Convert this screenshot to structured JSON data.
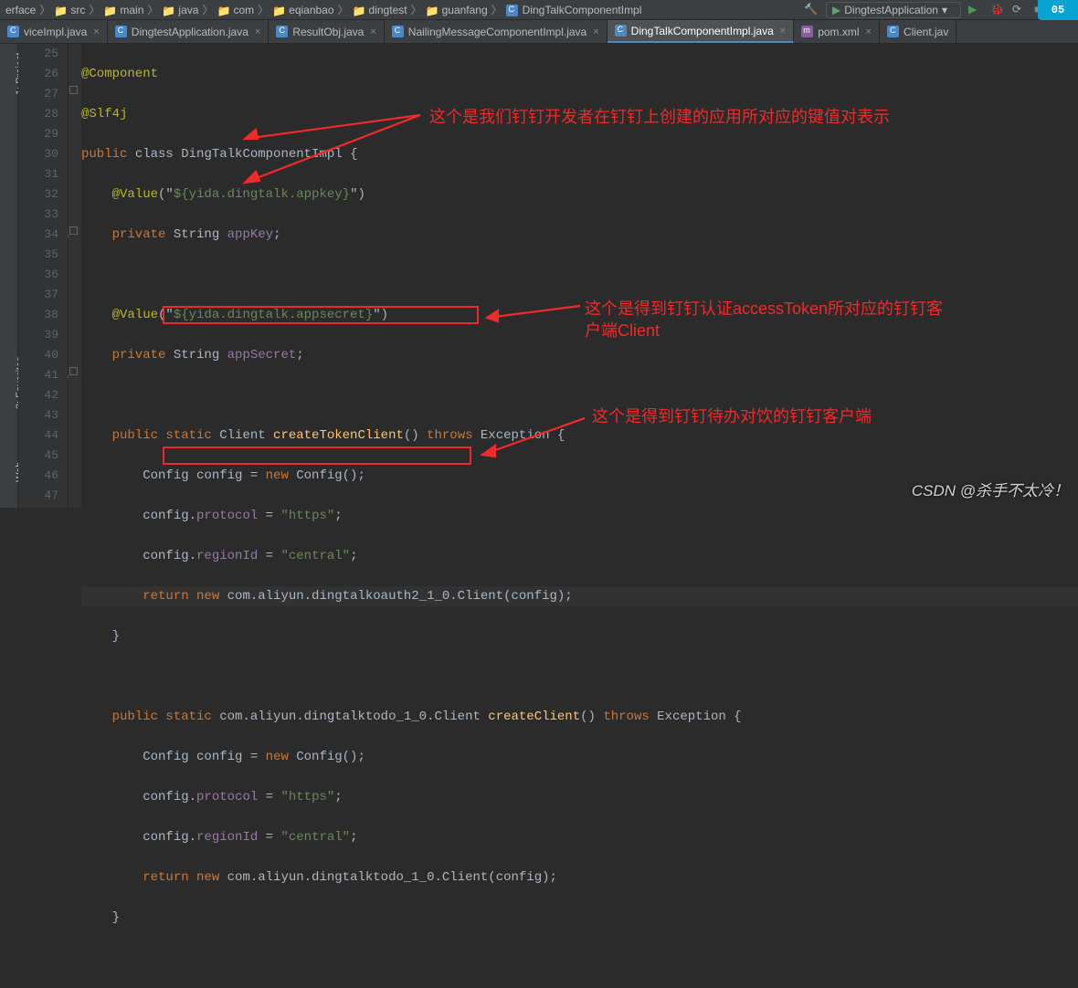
{
  "breadcrumb": {
    "parts": [
      "erface",
      "src",
      "main",
      "java",
      "com",
      "eqianbao",
      "dingtest",
      "guanfang",
      "DingTalkComponentImpl"
    ],
    "run_config": "DingtestApplication"
  },
  "tabs": [
    {
      "label": "viceImpl.java",
      "icon": "class-icon"
    },
    {
      "label": "DingtestApplication.java",
      "icon": "class-icon"
    },
    {
      "label": "ResultObj.java",
      "icon": "class-icon"
    },
    {
      "label": "NailingMessageComponentImpl.java",
      "icon": "class-icon"
    },
    {
      "label": "DingTalkComponentImpl.java",
      "icon": "class-icon",
      "active": true
    },
    {
      "label": "pom.xml",
      "icon": "maven-icon"
    },
    {
      "label": "Client.jav",
      "icon": "class-icon"
    }
  ],
  "gutter": {
    "start": 25,
    "end": 47
  },
  "code": {
    "l25": "@Component",
    "l26": "@Slf4j",
    "l27_a": "public",
    "l27_b": " class ",
    "l27_c": "DingTalkComponentImpl {",
    "l28_a": "    @Value",
    "l28_b": "(\"",
    "l28_c": "${yida.dingtalk.appkey}",
    "l28_d": "\")",
    "l29_a": "    private ",
    "l29_b": "String ",
    "l29_c": "appKey",
    "l29_d": ";",
    "l30": "",
    "l31_a": "    @Value",
    "l31_b": "(\"",
    "l31_c": "${yida.dingtalk.appsecret}",
    "l31_d": "\")",
    "l32_a": "    private ",
    "l32_b": "String ",
    "l32_c": "appSecret",
    "l32_d": ";",
    "l33": "",
    "l34_a": "    public static ",
    "l34_b": "Client ",
    "l34_c": "createTokenClient",
    "l34_d": "() ",
    "l34_e": "throws ",
    "l34_f": "Exception {",
    "l35_a": "        Config config = ",
    "l35_b": "new ",
    "l35_c": "Config();",
    "l36_a": "        config.",
    "l36_b": "protocol",
    "l36_c": " = ",
    "l36_d": "\"https\"",
    "l36_e": ";",
    "l37_a": "        config.",
    "l37_b": "regionId",
    "l37_c": " = ",
    "l37_d": "\"central\"",
    "l37_e": ";",
    "l38_a": "        return ",
    "l38_b": "new ",
    "l38_c": "com.aliyun.dingtalkoauth2_1_0.Client(config);",
    "l39": "    }",
    "l40": "",
    "l41_a": "    public static ",
    "l41_b": "com.aliyun.dingtalktodo_1_0.Client ",
    "l41_c": "createClient",
    "l41_d": "() ",
    "l41_e": "throws ",
    "l41_f": "Exception {",
    "l42_a": "        Config config = ",
    "l42_b": "new ",
    "l42_c": "Config();",
    "l43_a": "        config.",
    "l43_b": "protocol",
    "l43_c": " = ",
    "l43_d": "\"https\"",
    "l43_e": ";",
    "l44_a": "        config.",
    "l44_b": "regionId",
    "l44_c": " = ",
    "l44_d": "\"central\"",
    "l44_e": ";",
    "l45_a": "        return ",
    "l45_b": "new ",
    "l45_c": "com.aliyun.dingtalktodo_1_0.Client(config);",
    "l46": "    }",
    "l47": ""
  },
  "annotations": {
    "note1": "这个是我们钉钉开发者在钉钉上创建的应用所对应的键值对表示",
    "note2_a": "这个是得到钉钉认证accessToken所对应的钉钉客",
    "note2_b": "户端Client",
    "note3": "这个是得到钉钉待办对饮的钉钉客户端"
  },
  "sidebar_labels": {
    "project": "1: Project",
    "favorites": "2: Favorites",
    "web": "Web"
  },
  "watermark": "CSDN @杀手不太冷！",
  "corner": "05"
}
